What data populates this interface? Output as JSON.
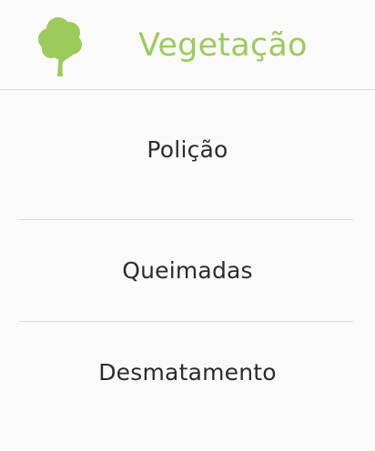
{
  "header": {
    "title": "Vegetação",
    "logo_icon": "tree-icon"
  },
  "menu": {
    "items": [
      {
        "label": "Polição"
      },
      {
        "label": "Queimadas"
      },
      {
        "label": "Desmatamento"
      }
    ]
  },
  "colors": {
    "accent": "#9ccb5b",
    "text": "#2b2b2b",
    "background": "#fafafa",
    "divider": "#dcdcdc"
  }
}
